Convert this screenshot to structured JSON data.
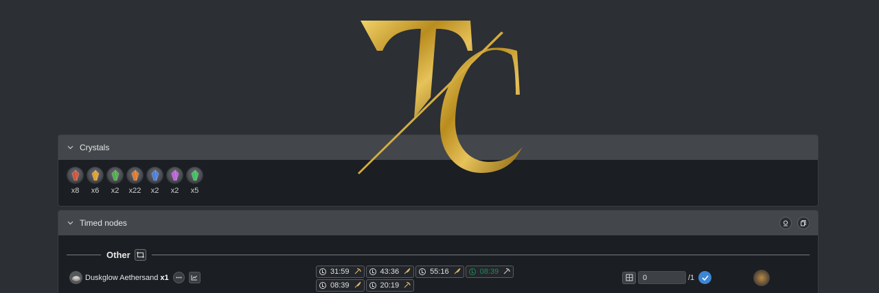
{
  "crystals": {
    "title": "Crystals",
    "items": [
      {
        "icon": "fire-crystal-icon",
        "color": "#d1533a",
        "count": "x8"
      },
      {
        "icon": "lightning-crystal-icon",
        "color": "#e0a030",
        "count": "x6"
      },
      {
        "icon": "wind-crystal-icon",
        "color": "#4fb04a",
        "count": "x2"
      },
      {
        "icon": "fire-cluster-icon",
        "color": "#e07a2e",
        "count": "x22"
      },
      {
        "icon": "ice-crystal-icon",
        "color": "#4a7fe0",
        "count": "x2"
      },
      {
        "icon": "earth-crystal-icon",
        "color": "#c060e0",
        "count": "x2"
      },
      {
        "icon": "wind-shard-icon",
        "color": "#3fc060",
        "count": "x5"
      }
    ]
  },
  "timed_nodes": {
    "title": "Timed nodes",
    "group_label": "Other",
    "item": {
      "name": "Duskglow Aethersand",
      "quantity": "x1"
    },
    "timers": [
      {
        "time": "31:59",
        "tool": "pickaxe-icon",
        "active": false
      },
      {
        "time": "43:36",
        "tool": "sickle-icon",
        "active": false
      },
      {
        "time": "55:16",
        "tool": "sickle-icon",
        "active": false
      },
      {
        "time": "08:39",
        "tool": "pickaxe-icon",
        "active": true
      },
      {
        "time": "08:39",
        "tool": "sickle-icon",
        "active": false
      },
      {
        "time": "20:19",
        "tool": "pickaxe-icon",
        "active": false
      }
    ],
    "progress": {
      "value": "0",
      "total": "/1"
    }
  },
  "colors": {
    "gold": "#c9a233",
    "active_timer": "#1f8a5a",
    "confirm_blue": "#3d86d6"
  }
}
